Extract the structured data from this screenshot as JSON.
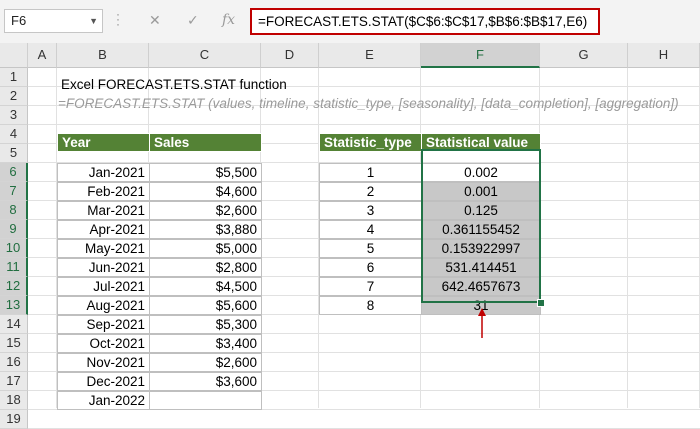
{
  "name_box": "F6",
  "formula_bar": {
    "cancel_icon": "✕",
    "enter_icon": "✓",
    "fx_label": "fx",
    "formula": "=FORECAST.ETS.STAT($C$6:$C$17,$B$6:$B$17,E6)"
  },
  "columns": [
    "A",
    "B",
    "C",
    "D",
    "E",
    "F",
    "G",
    "H"
  ],
  "rows": [
    "1",
    "2",
    "3",
    "4",
    "5",
    "6",
    "7",
    "8",
    "9",
    "10",
    "11",
    "12",
    "13",
    "14",
    "15",
    "16",
    "17",
    "18",
    "19"
  ],
  "selected_column": "F",
  "selected_rows": [
    "6",
    "7",
    "8",
    "9",
    "10",
    "11",
    "12",
    "13"
  ],
  "title": "Excel FORECAST.ETS.STAT function",
  "syntax": "=FORECAST.ETS.STAT (values, timeline, statistic_type, [seasonality], [data_completion], [aggregation])",
  "sales_table": {
    "headers": [
      "Year",
      "Sales"
    ],
    "rows": [
      {
        "year": "Jan-2021",
        "sales": "$5,500"
      },
      {
        "year": "Feb-2021",
        "sales": "$4,600"
      },
      {
        "year": "Mar-2021",
        "sales": "$2,600"
      },
      {
        "year": "Apr-2021",
        "sales": "$3,880"
      },
      {
        "year": "May-2021",
        "sales": "$5,000"
      },
      {
        "year": "Jun-2021",
        "sales": "$2,800"
      },
      {
        "year": "Jul-2021",
        "sales": "$4,500"
      },
      {
        "year": "Aug-2021",
        "sales": "$5,600"
      },
      {
        "year": "Sep-2021",
        "sales": "$5,300"
      },
      {
        "year": "Oct-2021",
        "sales": "$3,400"
      },
      {
        "year": "Nov-2021",
        "sales": "$2,600"
      },
      {
        "year": "Dec-2021",
        "sales": "$3,600"
      },
      {
        "year": "Jan-2022",
        "sales": ""
      }
    ]
  },
  "stat_table": {
    "headers": [
      "Statistic_type",
      "Statistical value"
    ],
    "rows": [
      {
        "type": "1",
        "value": "0.002"
      },
      {
        "type": "2",
        "value": "0.001"
      },
      {
        "type": "3",
        "value": "0.125"
      },
      {
        "type": "4",
        "value": "0.361155452"
      },
      {
        "type": "5",
        "value": "0.153922997"
      },
      {
        "type": "6",
        "value": "531.414451"
      },
      {
        "type": "7",
        "value": "642.4657673"
      },
      {
        "type": "8",
        "value": "31"
      }
    ]
  },
  "colors": {
    "header_green": "#548235",
    "selection_green": "#217346",
    "highlight_gray": "#c8c8c8",
    "arrow_red": "#c00000",
    "formula_border": "#c00000"
  }
}
